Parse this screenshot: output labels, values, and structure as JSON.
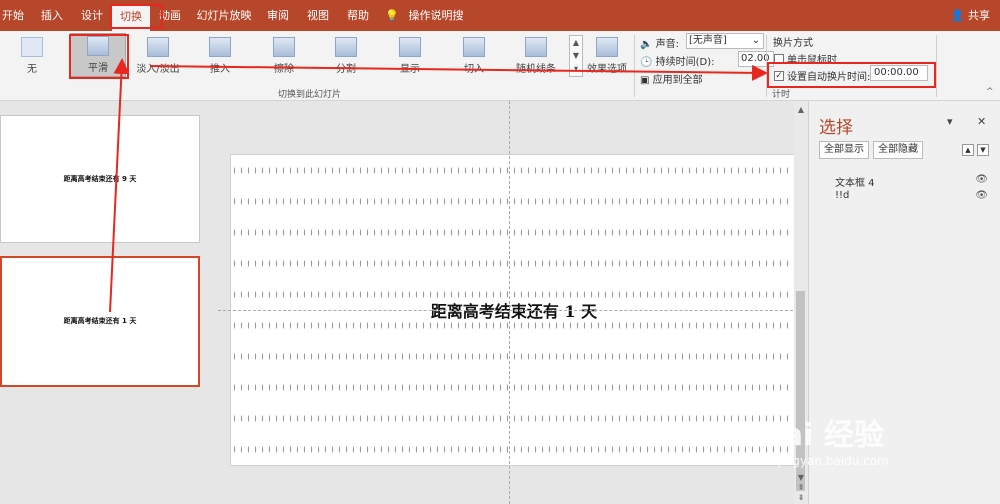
{
  "menubar": {
    "tabs": [
      "开始",
      "插入",
      "设计",
      "切换",
      "动画",
      "幻灯片放映",
      "审阅",
      "视图",
      "帮助",
      "操作说明搜索"
    ],
    "share": "共享"
  },
  "ribbon": {
    "transitions": [
      "无",
      "平滑",
      "淡入/淡出",
      "推入",
      "擦除",
      "分割",
      "显示",
      "切入",
      "随机线条"
    ],
    "effect_options": "效果选项",
    "group_label": "切换到此幻灯片",
    "sound_label": "声音:",
    "sound_value": "[无声音]",
    "duration_label": "持续时间(D):",
    "duration_value": "02.00",
    "apply_all": "应用到全部",
    "advance_title": "换片方式",
    "on_click": "单击鼠标时",
    "after_label": "设置自动换片时间:",
    "after_value": "00:00.00",
    "timing_label": "计时"
  },
  "thumbnails": [
    {
      "text": "距离高考结束还有 9 天"
    },
    {
      "text": "距离高考结束还有 1 天"
    }
  ],
  "slide": {
    "text": "距离高考结束还有 1 天"
  },
  "pane": {
    "title": "选择",
    "show_all": "全部显示",
    "hide_all": "全部隐藏",
    "items": [
      "文本框 4",
      "!!d"
    ]
  },
  "watermark": {
    "main": "Bai 经验",
    "sub": "jingyan.baidu.com"
  },
  "colors": {
    "accent": "#b7472a",
    "annotation": "#e8271f"
  }
}
